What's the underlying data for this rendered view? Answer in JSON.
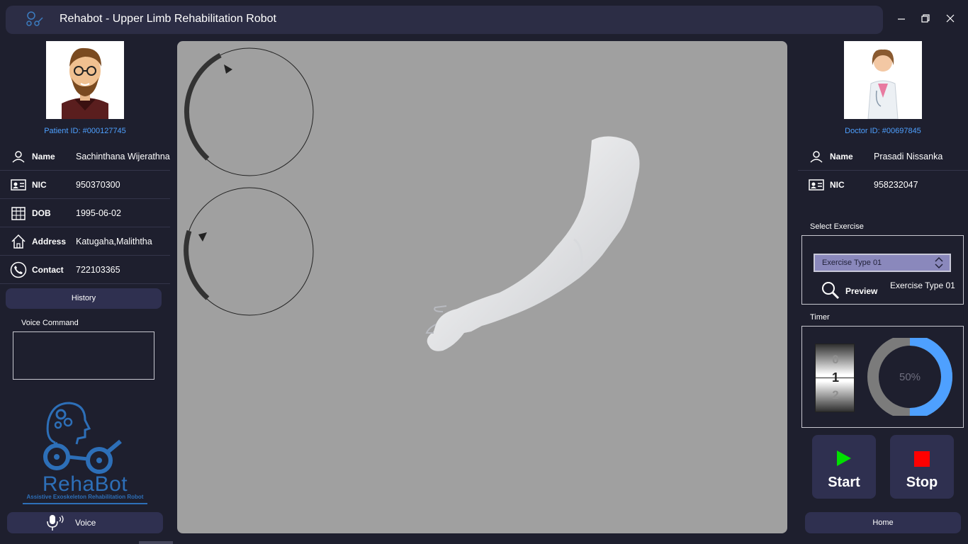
{
  "app": {
    "title": "Rehabot - Upper Limb Rehabilitation Robot",
    "logo_text": "RehaBot"
  },
  "window_controls": [
    "minimize-icon",
    "restore-icon",
    "close-icon"
  ],
  "patient": {
    "id_label": "Patient ID: #000127745",
    "rows": [
      {
        "icon": "user-icon",
        "key": "Name",
        "value": "Sachinthana Wijerathna"
      },
      {
        "icon": "id-card-icon",
        "key": "NIC",
        "value": "950370300"
      },
      {
        "icon": "calendar-icon",
        "key": "DOB",
        "value": "1995-06-02"
      },
      {
        "icon": "home-icon",
        "key": "Address",
        "value": "Katugaha,Maliththa"
      },
      {
        "icon": "phone-icon",
        "key": "Contact",
        "value": "722103365"
      }
    ],
    "history_label": "History",
    "voice_command_label": "Voice Command",
    "voice_command_value": "",
    "voice_label": "Voice"
  },
  "brand": {
    "name": "RehaBot",
    "tagline": "Assistive Exoskeleton Rehabilitation Robot"
  },
  "doctor": {
    "id_label": "Doctor ID: #00697845",
    "rows": [
      {
        "icon": "user-icon",
        "key": "Name",
        "value": "Prasadi Nissanka"
      },
      {
        "icon": "id-card-icon",
        "key": "NIC",
        "value": "958232047"
      }
    ]
  },
  "exercise": {
    "section_label": "Select Exercise",
    "selected": "Exercise Type 01",
    "preview_label": "Preview",
    "preview_value": "Exercise Type 01"
  },
  "timer": {
    "section_label": "Timer",
    "roller_digits": [
      "0",
      "1",
      "2"
    ],
    "progress_text": "50%",
    "progress_value": 0.5
  },
  "controls": {
    "start_label": "Start",
    "stop_label": "Stop",
    "home_label": "Home"
  },
  "colors": {
    "accent_blue": "#4ea0ff",
    "start_green": "#00e000",
    "stop_red": "#ff0000",
    "panel": "#2f3050",
    "background": "#1e1f2e"
  }
}
